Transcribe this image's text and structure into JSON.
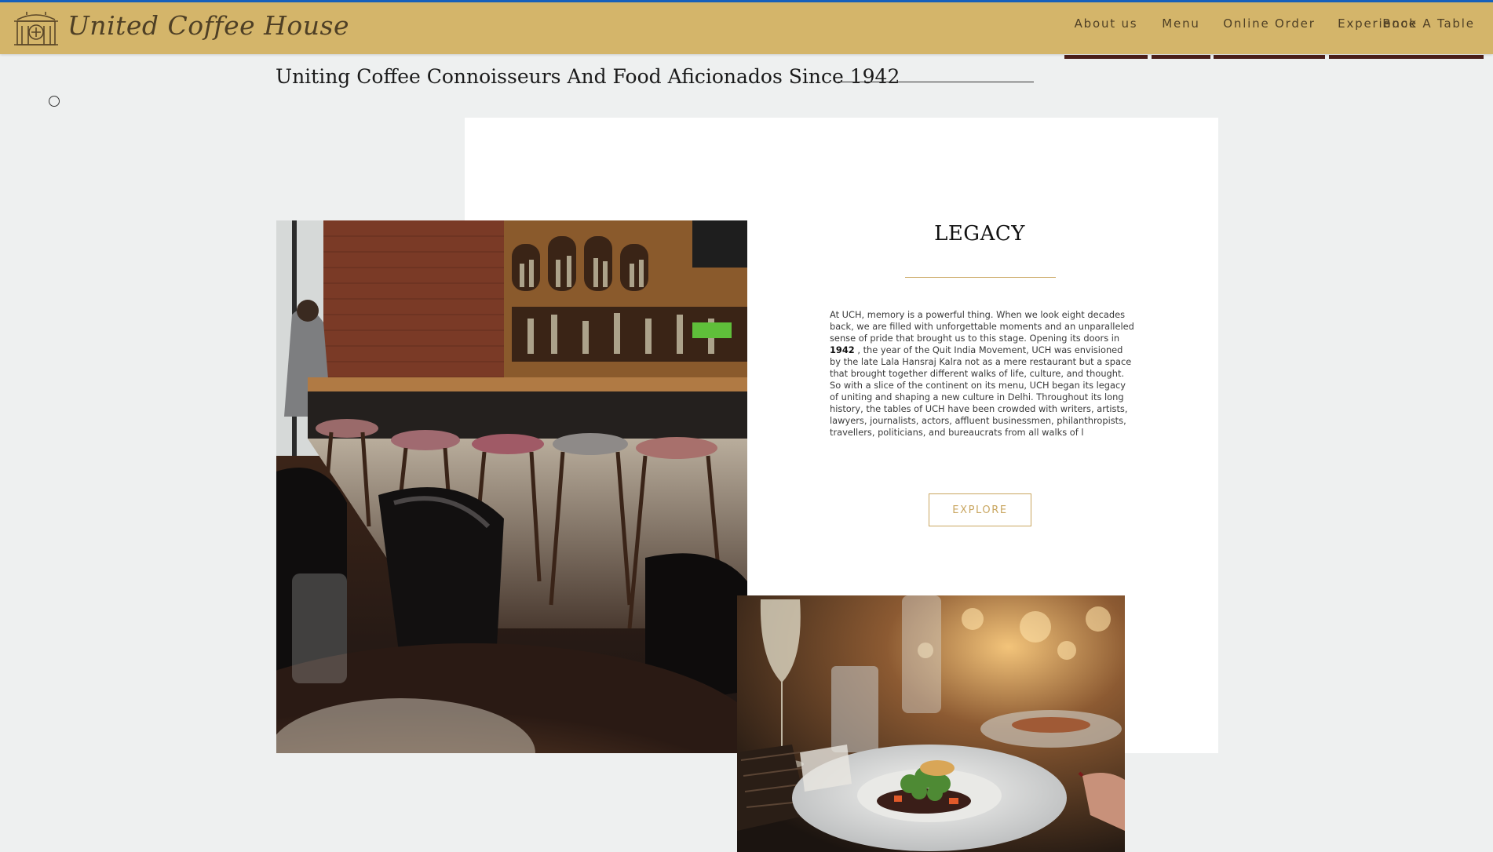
{
  "header": {
    "brand_name": "United Coffee House",
    "logo_icon": "coffee-house-emblem-icon",
    "nav_items": [
      {
        "label": "About us"
      },
      {
        "label": "Menu"
      },
      {
        "label": "Online Order"
      },
      {
        "label": "Experience"
      },
      {
        "label": "Book A Table"
      }
    ]
  },
  "colors": {
    "header_bg": "#d4b56a",
    "nav_underline": "#4a1e1a",
    "accent_gold": "#c9a660",
    "page_bg": "#eef0f0",
    "top_line": "#1560bd"
  },
  "hero": {
    "tagline": "Uniting Coffee Connoisseurs And Food Aficionados Since 1942"
  },
  "legacy": {
    "title": "LEGACY",
    "text_before_year": "At UCH, memory is a powerful thing. When we look eight decades back, we are filled with unforgettable moments and an unparalleled sense of pride that brought us to this stage. Opening its doors in ",
    "year": "1942",
    "text_after_year": " , the year of the Quit India Movement, UCH was envisioned by the late Lala Hansraj Kalra not as a mere restaurant but a space that brought together different walks of life, culture, and thought. So with a slice of the continent on its menu, UCH began its legacy of uniting and shaping a new culture in Delhi. Throughout its long history, the tables of UCH have been crowded with writers, artists, lawyers, journalists, actors, affluent businessmen, philanthropists, travellers, politicians, and bureaucrats from all walks of l",
    "button_label": "EXPLORE"
  },
  "images": {
    "bar_photo": "restaurant-bar-interior-photo",
    "dinner_photo": "plated-dinner-table-photo"
  }
}
